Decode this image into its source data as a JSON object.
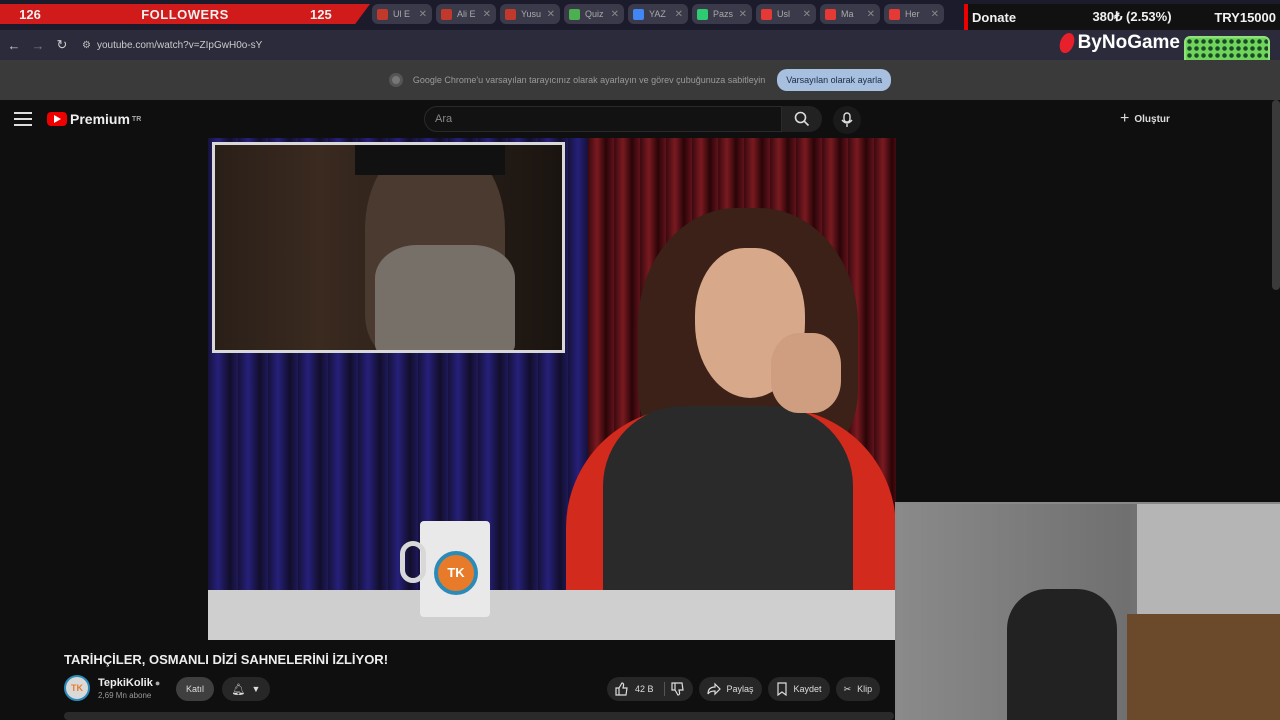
{
  "overlay": {
    "followers_current": "126",
    "followers_label": "FOLLOWERS",
    "followers_target": "125",
    "donate_label": "Donate",
    "donate_progress": "380₺ (2.53%)",
    "donate_goal": "TRY15000",
    "sponsor": "ByNoGame"
  },
  "browser": {
    "tabs": [
      {
        "title": "Ul E",
        "color": "#c0392b"
      },
      {
        "title": "Ali E",
        "color": "#c0392b"
      },
      {
        "title": "Yusu",
        "color": "#c0392b"
      },
      {
        "title": "Quiz",
        "color": "#4caf50"
      },
      {
        "title": "YAZ",
        "color": "#4285f4"
      },
      {
        "title": "Pazs",
        "color": "#2ecc71"
      },
      {
        "title": "Usl",
        "color": "#e53935"
      },
      {
        "title": "Ma",
        "color": "#e53935"
      },
      {
        "title": "Her",
        "color": "#e53935"
      },
      {
        "title": "",
        "color": "#e53935"
      }
    ],
    "url": "youtube.com/watch?v=ZIpGwH0o-sY",
    "infobar_text": "Google Chrome'u varsayılan tarayıcınız olarak ayarlayın ve görev çubuğunuza sabitleyin",
    "infobar_button": "Varsayılan olarak ayarla"
  },
  "youtube": {
    "logo": "Premium",
    "logo_region": "TR",
    "search_placeholder": "Ara",
    "create_label": "Oluştur",
    "video_title": "TARİHÇİLER, OSMANLI DİZİ SAHNELERİNİ İZLİYOR!",
    "channel_name": "TepkiKolik",
    "channel_avatar": "TK",
    "subscribers": "2,69 Mn abone",
    "join_label": "Katıl",
    "likes": "42 B",
    "share_label": "Paylaş",
    "save_label": "Kaydet",
    "clip_label": "Klip",
    "mug_logo": "TK"
  }
}
